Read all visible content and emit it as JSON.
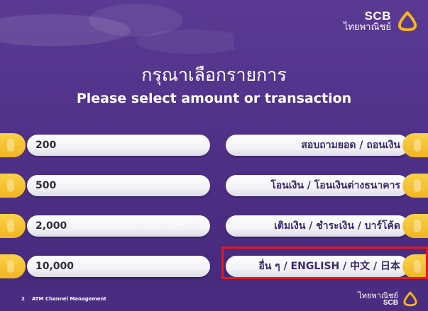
{
  "brand": {
    "name_en": "SCB",
    "name_th": "ไทยพาณิชย์",
    "logo_color": "#f4b521"
  },
  "screen": {
    "title_th": "กรุณาเลือกรายการ",
    "title_en": "Please select amount or transaction"
  },
  "amounts": [
    "200",
    "500",
    "2,000",
    "10,000"
  ],
  "transactions": [
    "สอบถามยอด / ถอนเงิน",
    "โอนเงิน / โอนเงินต่างธนาคาร",
    "เติมเงิน / ชำระเงิน / บาร์โค้ด",
    "อื่น ๆ / ENGLISH / 中文 / 日本"
  ],
  "footer": {
    "page_number": "2",
    "caption": "ATM Channel Management",
    "brand_th": "ไทยพาณิชย์",
    "brand_en": "SCB"
  },
  "colors": {
    "background": "#4e2f86",
    "accent_tab": "#f1b523",
    "highlight": "#e2191f"
  }
}
